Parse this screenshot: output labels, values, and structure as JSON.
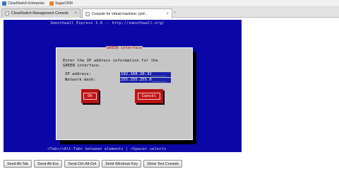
{
  "bookmarks": [
    {
      "label": "CloudSwitch Enterprise",
      "icon": "cloud-icon"
    },
    {
      "label": "SugarCRM",
      "icon": "sugarcrm-icon"
    }
  ],
  "tabs": [
    {
      "label": "CloudSwitch Management Console",
      "active": false
    },
    {
      "label": "Console for virtual machine: (unf...",
      "active": true
    }
  ],
  "console": {
    "title": "Smoothwall Express 3.0 -- http://smoothwall.org/",
    "help": "<Tab>/<Alt-Tab> between elements   |  <Space> selects",
    "dialog": {
      "title": "GREEN interface",
      "text": "Enter the IP address information for the\nGREEN interface.",
      "ip_label": "IP address:",
      "ip_value": "192.168.20.32______",
      "mask_label": "Network mask:",
      "mask_value": "255.255.255.0______",
      "ok_label": "Ok",
      "cancel_label": "Cancel"
    }
  },
  "actions": [
    "Send Alt-Tab",
    "Send Alt-Esc",
    "Send Ctrl-Alt-Del",
    "Send Windows Key",
    "Show Text Console"
  ]
}
